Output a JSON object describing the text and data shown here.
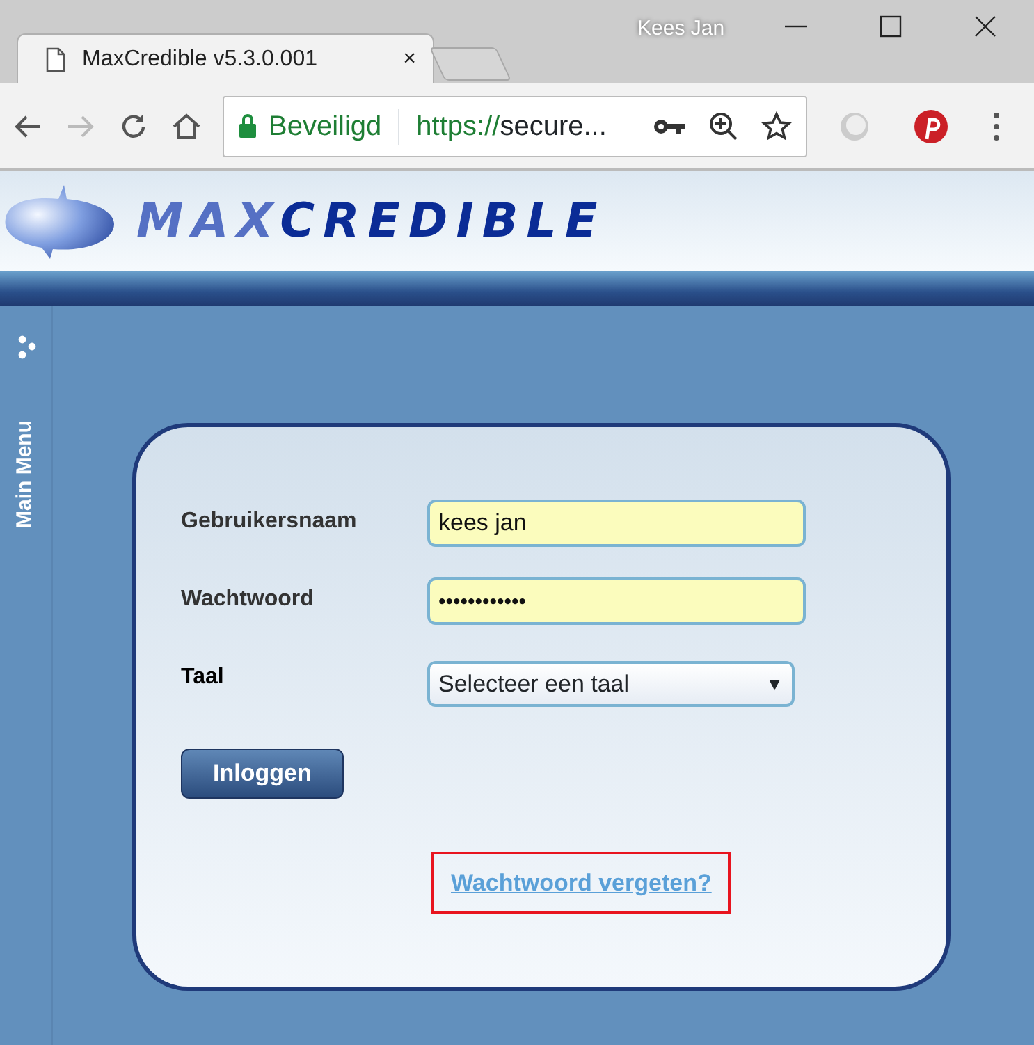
{
  "window": {
    "user": "Kees Jan"
  },
  "tabs": [
    {
      "title": "MaxCredible v5.3.0.001",
      "close": "×",
      "selected": true
    }
  ],
  "address_bar": {
    "security": "Beveiligd",
    "scheme": "https://",
    "url": "secure..."
  },
  "logo": {
    "light": "MAX",
    "dark": "CREDIBLE"
  },
  "sidebar": {
    "label": "Main Menu"
  },
  "login": {
    "fields": [
      {
        "kind": "text",
        "label": "Gebruikersnaam",
        "value": "kees jan"
      },
      {
        "kind": "password",
        "label": "Wachtwoord",
        "value": "••••••••••••"
      },
      {
        "kind": "select",
        "label": "Taal",
        "value": "Selecteer een taal",
        "arrow": "▼"
      }
    ],
    "button": "Inloggen",
    "link": {
      "text": "Wachtwoord vergeten?",
      "highlighted": true
    }
  }
}
